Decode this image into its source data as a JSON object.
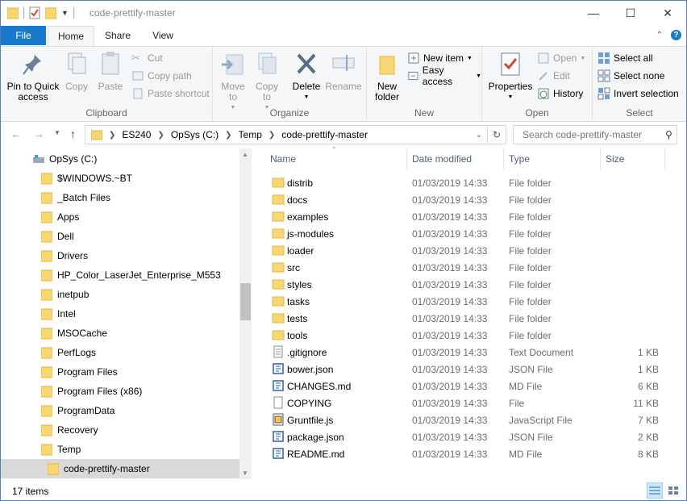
{
  "window": {
    "title": "code-prettify-master",
    "controls": {
      "minimize": "—",
      "maximize": "☐",
      "close": "✕"
    }
  },
  "ribbon_tabs": [
    {
      "label": "File"
    },
    {
      "label": "Home"
    },
    {
      "label": "Share"
    },
    {
      "label": "View"
    }
  ],
  "ribbon": {
    "clipboard": {
      "label": "Clipboard",
      "pin": "Pin to Quick access",
      "copy": "Copy",
      "paste": "Paste",
      "cut": "Cut",
      "copy_path": "Copy path",
      "paste_shortcut": "Paste shortcut"
    },
    "organize": {
      "label": "Organize",
      "move_to": "Move to",
      "copy_to": "Copy to",
      "delete": "Delete",
      "rename": "Rename"
    },
    "new": {
      "label": "New",
      "new_folder": "New folder",
      "new_item": "New item",
      "easy_access": "Easy access"
    },
    "open": {
      "label": "Open",
      "properties": "Properties",
      "open": "Open",
      "edit": "Edit",
      "history": "History"
    },
    "select": {
      "label": "Select",
      "select_all": "Select all",
      "select_none": "Select none",
      "invert_selection": "Invert selection"
    }
  },
  "address": {
    "breadcrumbs": [
      "ES240",
      "OpSys (C:)",
      "Temp",
      "code-prettify-master"
    ],
    "search_placeholder": "Search code-prettify-master"
  },
  "nav_pane": {
    "drive": "OpSys (C:)",
    "items": [
      "$WINDOWS.~BT",
      "_Batch Files",
      "Apps",
      "Dell",
      "Drivers",
      "HP_Color_LaserJet_Enterprise_M553",
      "inetpub",
      "Intel",
      "MSOCache",
      "PerfLogs",
      "Program Files",
      "Program Files (x86)",
      "ProgramData",
      "Recovery",
      "Temp"
    ],
    "selected": "code-prettify-master"
  },
  "columns": {
    "name": "Name",
    "date": "Date modified",
    "type": "Type",
    "size": "Size"
  },
  "files": [
    {
      "name": "distrib",
      "date": "01/03/2019 14:33",
      "type": "File folder",
      "size": "",
      "icon": "folder-icon"
    },
    {
      "name": "docs",
      "date": "01/03/2019 14:33",
      "type": "File folder",
      "size": "",
      "icon": "folder-icon"
    },
    {
      "name": "examples",
      "date": "01/03/2019 14:33",
      "type": "File folder",
      "size": "",
      "icon": "folder-icon"
    },
    {
      "name": "js-modules",
      "date": "01/03/2019 14:33",
      "type": "File folder",
      "size": "",
      "icon": "folder-icon"
    },
    {
      "name": "loader",
      "date": "01/03/2019 14:33",
      "type": "File folder",
      "size": "",
      "icon": "folder-icon"
    },
    {
      "name": "src",
      "date": "01/03/2019 14:33",
      "type": "File folder",
      "size": "",
      "icon": "folder-icon"
    },
    {
      "name": "styles",
      "date": "01/03/2019 14:33",
      "type": "File folder",
      "size": "",
      "icon": "folder-icon"
    },
    {
      "name": "tasks",
      "date": "01/03/2019 14:33",
      "type": "File folder",
      "size": "",
      "icon": "folder-icon"
    },
    {
      "name": "tests",
      "date": "01/03/2019 14:33",
      "type": "File folder",
      "size": "",
      "icon": "folder-icon"
    },
    {
      "name": "tools",
      "date": "01/03/2019 14:33",
      "type": "File folder",
      "size": "",
      "icon": "folder-icon"
    },
    {
      "name": ".gitignore",
      "date": "01/03/2019 14:33",
      "type": "Text Document",
      "size": "1 KB",
      "icon": "text-file-icon"
    },
    {
      "name": "bower.json",
      "date": "01/03/2019 14:33",
      "type": "JSON File",
      "size": "1 KB",
      "icon": "code-file-icon"
    },
    {
      "name": "CHANGES.md",
      "date": "01/03/2019 14:33",
      "type": "MD File",
      "size": "6 KB",
      "icon": "code-file-icon"
    },
    {
      "name": "COPYING",
      "date": "01/03/2019 14:33",
      "type": "File",
      "size": "11 KB",
      "icon": "blank-file-icon"
    },
    {
      "name": "Gruntfile.js",
      "date": "01/03/2019 14:33",
      "type": "JavaScript File",
      "size": "7 KB",
      "icon": "script-file-icon"
    },
    {
      "name": "package.json",
      "date": "01/03/2019 14:33",
      "type": "JSON File",
      "size": "2 KB",
      "icon": "code-file-icon"
    },
    {
      "name": "README.md",
      "date": "01/03/2019 14:33",
      "type": "MD File",
      "size": "8 KB",
      "icon": "code-file-icon"
    }
  ],
  "status": {
    "count": "17 items"
  },
  "colors": {
    "accent": "#1979ca",
    "folder": "#f7d774",
    "folder_dark": "#e4b73c",
    "selection": "#d9d9d9"
  }
}
